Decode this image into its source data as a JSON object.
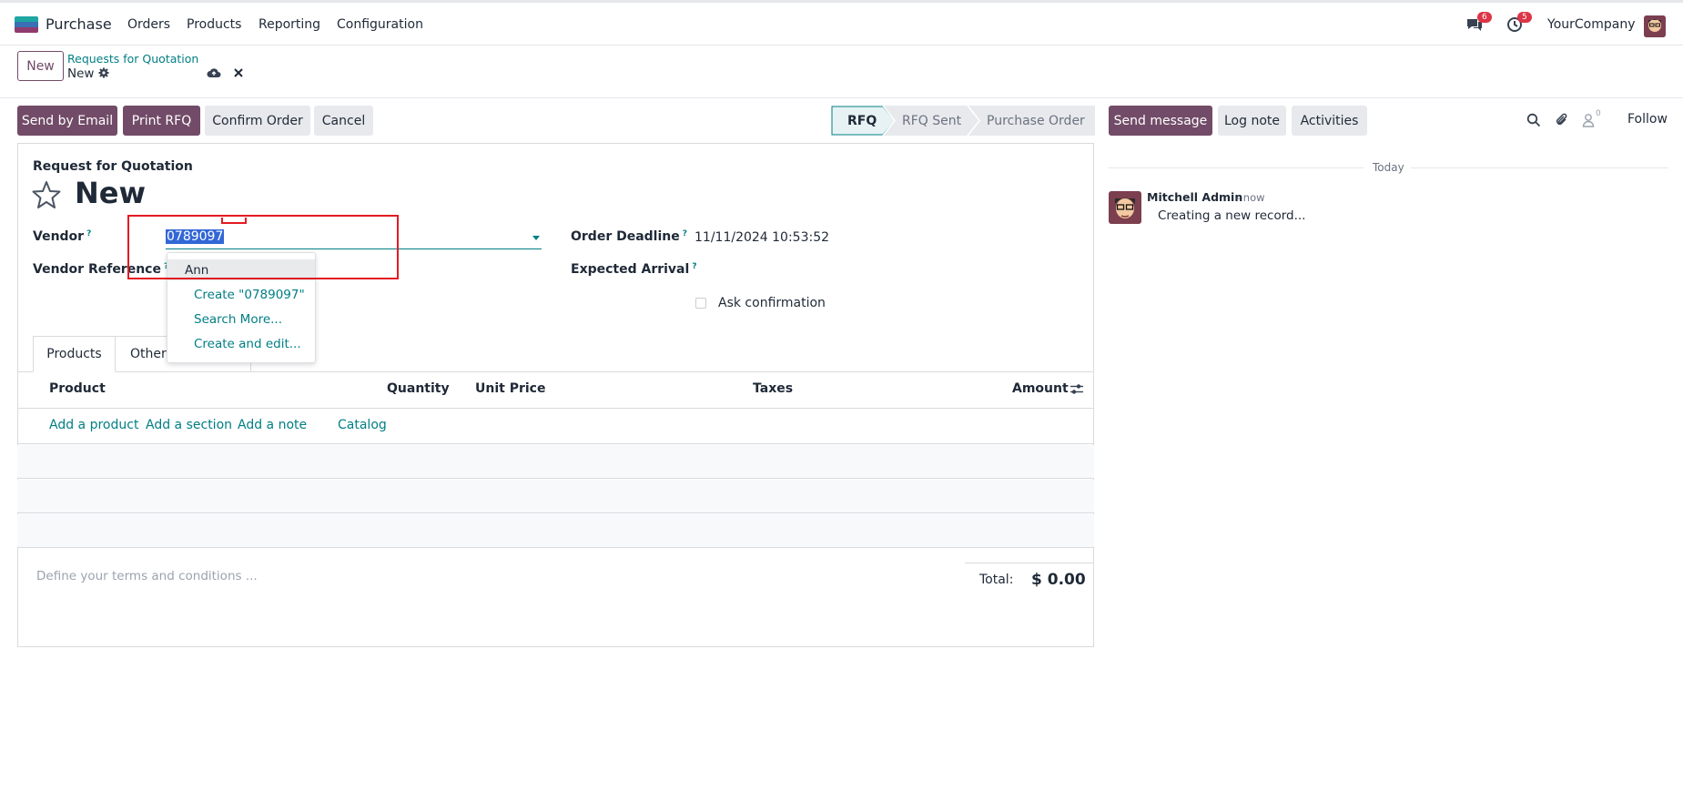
{
  "nav": {
    "app_name": "Purchase",
    "menu": [
      "Orders",
      "Products",
      "Reporting",
      "Configuration"
    ],
    "messages_badge": "6",
    "activities_badge": "5",
    "company": "YourCompany"
  },
  "control": {
    "new_button": "New",
    "breadcrumb_parent": "Requests for Quotation",
    "breadcrumb_current": "New"
  },
  "actions": {
    "send_email": "Send by Email",
    "print_rfq": "Print RFQ",
    "confirm_order": "Confirm Order",
    "cancel": "Cancel"
  },
  "statusbar": {
    "stages": [
      "RFQ",
      "RFQ Sent",
      "Purchase Order"
    ],
    "active_stage": "RFQ"
  },
  "chatter": {
    "send_message": "Send message",
    "log_note": "Log note",
    "activities": "Activities",
    "followers_count": "0",
    "follow": "Follow",
    "date_separator": "Today",
    "message": {
      "author": "Mitchell Admin",
      "time": "- now",
      "body": "Creating a new record..."
    }
  },
  "form": {
    "doc_type": "Request for Quotation",
    "title": "New",
    "vendor_label": "Vendor",
    "vendor_value": "0789097",
    "vendor_reference_label": "Vendor Reference",
    "order_deadline_label": "Order Deadline",
    "order_deadline_value": "11/11/2024 10:53:52",
    "expected_arrival_label": "Expected Arrival",
    "ask_confirmation_label": "Ask confirmation",
    "help_mark": "?"
  },
  "vendor_dropdown": {
    "items": [
      "Ann",
      "Create \"0789097\"",
      "Search More...",
      "Create and edit..."
    ]
  },
  "tabs": {
    "products": "Products",
    "other": "Other"
  },
  "lines": {
    "columns": [
      "Product",
      "Quantity",
      "Unit Price",
      "Taxes",
      "Amount"
    ],
    "add_product": "Add a product",
    "add_section": "Add a section",
    "add_note": "Add a note",
    "catalog": "Catalog"
  },
  "footer": {
    "terms_placeholder": "Define your terms and conditions ...",
    "total_label": "Total:",
    "total_value": "$ 0.00"
  },
  "colors": {
    "brand": "#714b67",
    "link": "#017e84",
    "highlight_box": "#e31b23"
  }
}
